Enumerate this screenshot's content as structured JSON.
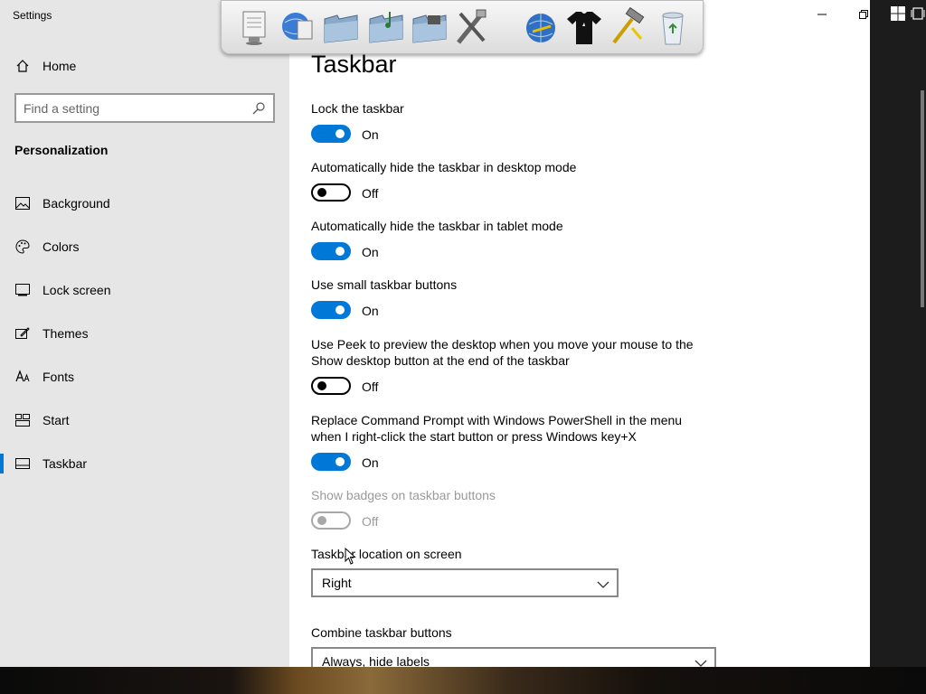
{
  "window": {
    "title": "Settings"
  },
  "sidebar": {
    "home_label": "Home",
    "search": {
      "placeholder": "Find a setting",
      "value": ""
    },
    "section_heading": "Personalization",
    "items": [
      {
        "label": "Background",
        "icon": "image-icon"
      },
      {
        "label": "Colors",
        "icon": "palette-icon"
      },
      {
        "label": "Lock screen",
        "icon": "lock-screen-icon"
      },
      {
        "label": "Themes",
        "icon": "themes-icon"
      },
      {
        "label": "Fonts",
        "icon": "fonts-icon"
      },
      {
        "label": "Start",
        "icon": "start-icon"
      },
      {
        "label": "Taskbar",
        "icon": "taskbar-icon",
        "selected": true
      }
    ]
  },
  "main": {
    "title": "Taskbar",
    "settings": [
      {
        "label": "Lock the taskbar",
        "state": "On",
        "on": true,
        "enabled": true
      },
      {
        "label": "Automatically hide the taskbar in desktop mode",
        "state": "Off",
        "on": false,
        "enabled": true
      },
      {
        "label": "Automatically hide the taskbar in tablet mode",
        "state": "On",
        "on": true,
        "enabled": true
      },
      {
        "label": "Use small taskbar buttons",
        "state": "On",
        "on": true,
        "enabled": true
      },
      {
        "label": "Use Peek to preview the desktop when you move your mouse to the Show desktop button at the end of the taskbar",
        "state": "Off",
        "on": false,
        "enabled": true
      },
      {
        "label": "Replace Command Prompt with Windows PowerShell in the menu when I right-click the start button or press Windows key+X",
        "state": "On",
        "on": true,
        "enabled": true
      },
      {
        "label": "Show badges on taskbar buttons",
        "state": "Off",
        "on": false,
        "enabled": false
      }
    ],
    "location": {
      "label": "Taskbar location on screen",
      "value": "Right"
    },
    "combine": {
      "label": "Combine taskbar buttons",
      "value": "Always, hide labels"
    }
  },
  "colors": {
    "accent": "#0078d7",
    "sidebar_bg": "#e6e6e6",
    "disabled": "#9a9a9a"
  },
  "dock_icons": [
    "notepad-icon",
    "globe-document-icon",
    "folder-icon",
    "music-folder-icon",
    "folder-icon",
    "tools-icon",
    "globe-icon",
    "tshirt-icon",
    "hammer-icon",
    "recycle-bin-icon"
  ]
}
